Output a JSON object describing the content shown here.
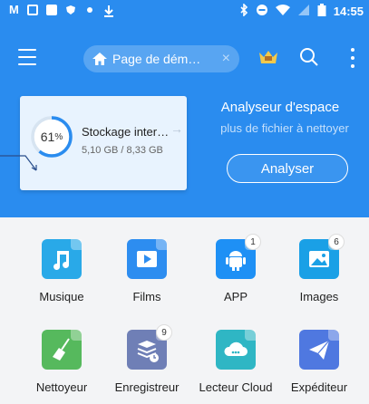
{
  "status_bar": {
    "time": "14:55"
  },
  "toolbar": {
    "location": "Page de dém…",
    "close_glyph": "×"
  },
  "storage_card": {
    "percent": "61",
    "percent_unit": "%",
    "name": "Stockage inter…",
    "arrow": "→",
    "size": "5,10 GB / 8,33 GB",
    "used_fraction": 0.61
  },
  "analyser": {
    "title": "Analyseur d'espace",
    "subtitle": "plus de fichier à nettoyer",
    "button": "Analyser"
  },
  "apps": [
    {
      "label": "Musique",
      "icon": "music-icon",
      "color": "#29a9e8",
      "badge": ""
    },
    {
      "label": "Films",
      "icon": "film-icon",
      "color": "#2d8df0",
      "badge": ""
    },
    {
      "label": "APP",
      "icon": "android-icon",
      "color": "#1e90f5",
      "badge": "1"
    },
    {
      "label": "Images",
      "icon": "image-icon",
      "color": "#1aa0e6",
      "badge": "6"
    },
    {
      "label": "Nettoyeur",
      "icon": "broom-icon",
      "color": "#56b95d",
      "badge": ""
    },
    {
      "label": "Enregistreur",
      "icon": "recorder-icon",
      "color": "#6f7fb6",
      "badge": "9"
    },
    {
      "label": "Lecteur Cloud",
      "icon": "cloud-icon",
      "color": "#2fb6c4",
      "badge": ""
    },
    {
      "label": "Expéditeur",
      "icon": "send-icon",
      "color": "#4f78e0",
      "badge": ""
    }
  ],
  "colors": {
    "primary": "#2a8cef",
    "background": "#f3f4f6"
  }
}
